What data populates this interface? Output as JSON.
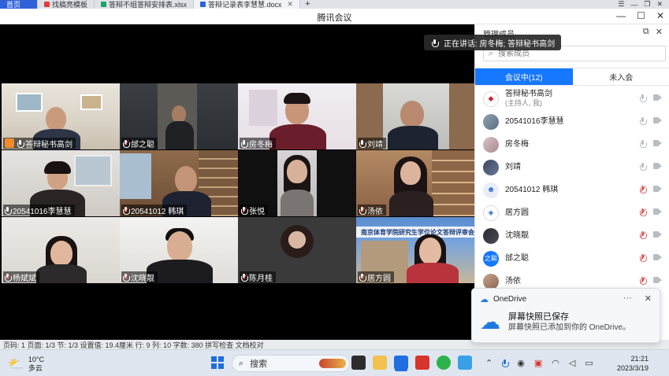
{
  "browser": {
    "tabs": [
      {
        "label": "首页",
        "active": true
      },
      {
        "label": "找稿亮模板"
      },
      {
        "label": "答辩不组答辩安排表.xlsx"
      },
      {
        "label": "答辩记录表李慧慧.docx"
      }
    ]
  },
  "window": {
    "title": "腾讯会议"
  },
  "speaking": {
    "text": "正在讲话: 房冬梅; 答辩秘书高剑"
  },
  "tiles": [
    {
      "name": "答辩秘书高剑",
      "host": true
    },
    {
      "name": "邰之聪"
    },
    {
      "name": "房冬梅"
    },
    {
      "name": "刘靖"
    },
    {
      "name": "20541016李慧慧"
    },
    {
      "name": "20541012 韩琪"
    },
    {
      "name": "张悦"
    },
    {
      "name": "汤依"
    },
    {
      "name": "杨斌斌"
    },
    {
      "name": "沈晓靓"
    },
    {
      "name": "陈月桂"
    },
    {
      "name": "居方圆",
      "banner": "南京体育学院研究生学位论文答辩评审会"
    }
  ],
  "panel": {
    "title": "管理成员",
    "search_placeholder": "搜索成员",
    "tabs": {
      "in_meeting": "会议中(12)",
      "not_joined": "未入会"
    },
    "members": [
      {
        "name": "答辩秘书高剑",
        "role": "(主持人, 我)",
        "avatar": "logo",
        "muted": false
      },
      {
        "name": "20541016李慧慧",
        "avatar": "photo",
        "muted": false
      },
      {
        "name": "房冬梅",
        "avatar": "photo",
        "muted": false
      },
      {
        "name": "刘靖",
        "avatar": "photo",
        "muted": false
      },
      {
        "name": "20541012 韩琪",
        "avatar": "cartoon",
        "muted": true
      },
      {
        "name": "居方圆",
        "avatar": "logo",
        "muted": true
      },
      {
        "name": "沈晓靓",
        "avatar": "dark",
        "muted": true
      },
      {
        "name": "邰之聪",
        "avatar": "text",
        "avatar_text": "之聪",
        "muted": true
      },
      {
        "name": "汤依",
        "avatar": "photo",
        "muted": true
      }
    ]
  },
  "statusbar": {
    "text": "页码: 1   页面: 1/3   节: 1/3   设置值: 19.4厘米   行: 9   列: 10   字数: 380   拼写检查   文档校对"
  },
  "toast": {
    "app": "OneDrive",
    "main": "屏幕快照已保存",
    "sub": "屏幕快照已添加到你的 OneDrive。"
  },
  "taskbar": {
    "temp": "10°C",
    "weather": "多云",
    "search_label": "搜索",
    "time": "21:21",
    "date": "2023/3/19"
  }
}
